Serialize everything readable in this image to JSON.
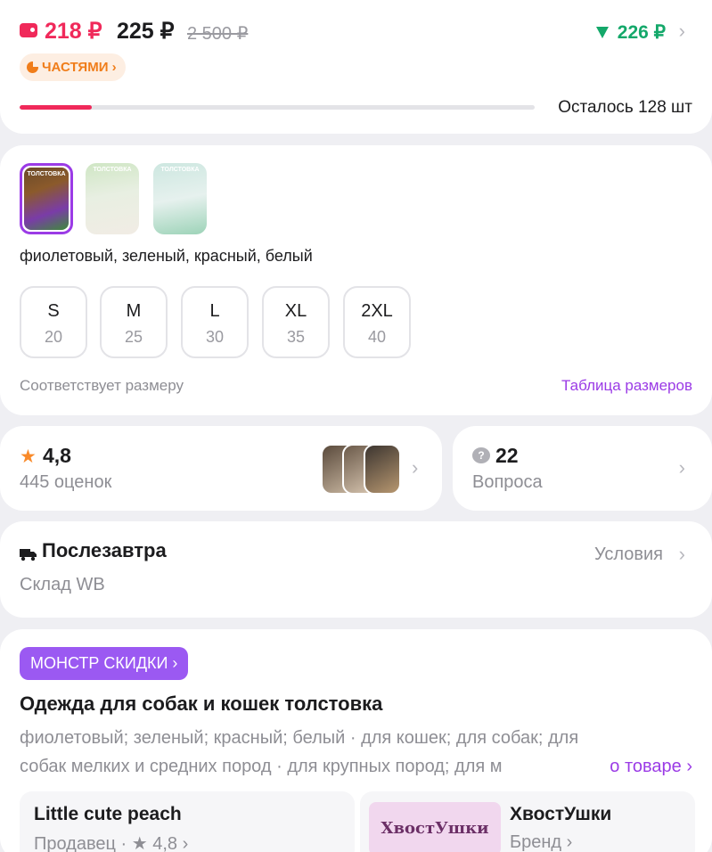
{
  "price": {
    "wallet_price": "218 ₽",
    "price": "225 ₽",
    "old_price": "2 500 ₽",
    "alt_price": "226 ₽",
    "installments_label": "ЧАСТЯМИ ›",
    "stock_fill": 0.14,
    "stock_text": "Осталось 128 шт"
  },
  "variants": {
    "swatch_labels": [
      "ТОЛСТОВКА",
      "ТОЛСТОВКА",
      "ТОЛСТОВКА"
    ],
    "colors_text": "фиолетовый, зеленый, красный, белый",
    "sizes": [
      {
        "size": "S",
        "ru": "20"
      },
      {
        "size": "M",
        "ru": "25"
      },
      {
        "size": "L",
        "ru": "30"
      },
      {
        "size": "XL",
        "ru": "35"
      },
      {
        "size": "2XL",
        "ru": "40"
      }
    ],
    "fit_text": "Соответствует размеру",
    "size_table_link": "Таблица размеров"
  },
  "rating": {
    "value": "4,8",
    "count": "445 оценок"
  },
  "questions": {
    "count": "22",
    "label": "Вопроса"
  },
  "delivery": {
    "title": "Послезавтра",
    "warehouse": "Склад WB",
    "conditions": "Условия"
  },
  "product": {
    "badge": "МОНСТР СКИДКИ ›",
    "title": "Одежда для собак и кошек толстовка",
    "desc_line1": "фиолетовый; зеленый; красный; белый · для кошек; для собак; для",
    "desc_line2": "собак мелких и средних пород · для крупных пород; для м",
    "more_link": "о товаре ›",
    "seller_name": "Little cute peach",
    "seller_sub": "Продавец · ★ 4,8 ›",
    "brand_logo_text": "ХвостУшки",
    "brand_name": "ХвостУшки",
    "brand_sub": "Бренд ›"
  },
  "colors": {
    "accent_red": "#f0295a",
    "accent_purple": "#9b3be6",
    "accent_green": "#14a86a",
    "accent_orange": "#f07d1a"
  },
  "icons": [
    "wallet-icon",
    "pie-chart-icon",
    "star-icon",
    "question-bubble-icon",
    "truck-icon",
    "chevron-right-icon"
  ]
}
